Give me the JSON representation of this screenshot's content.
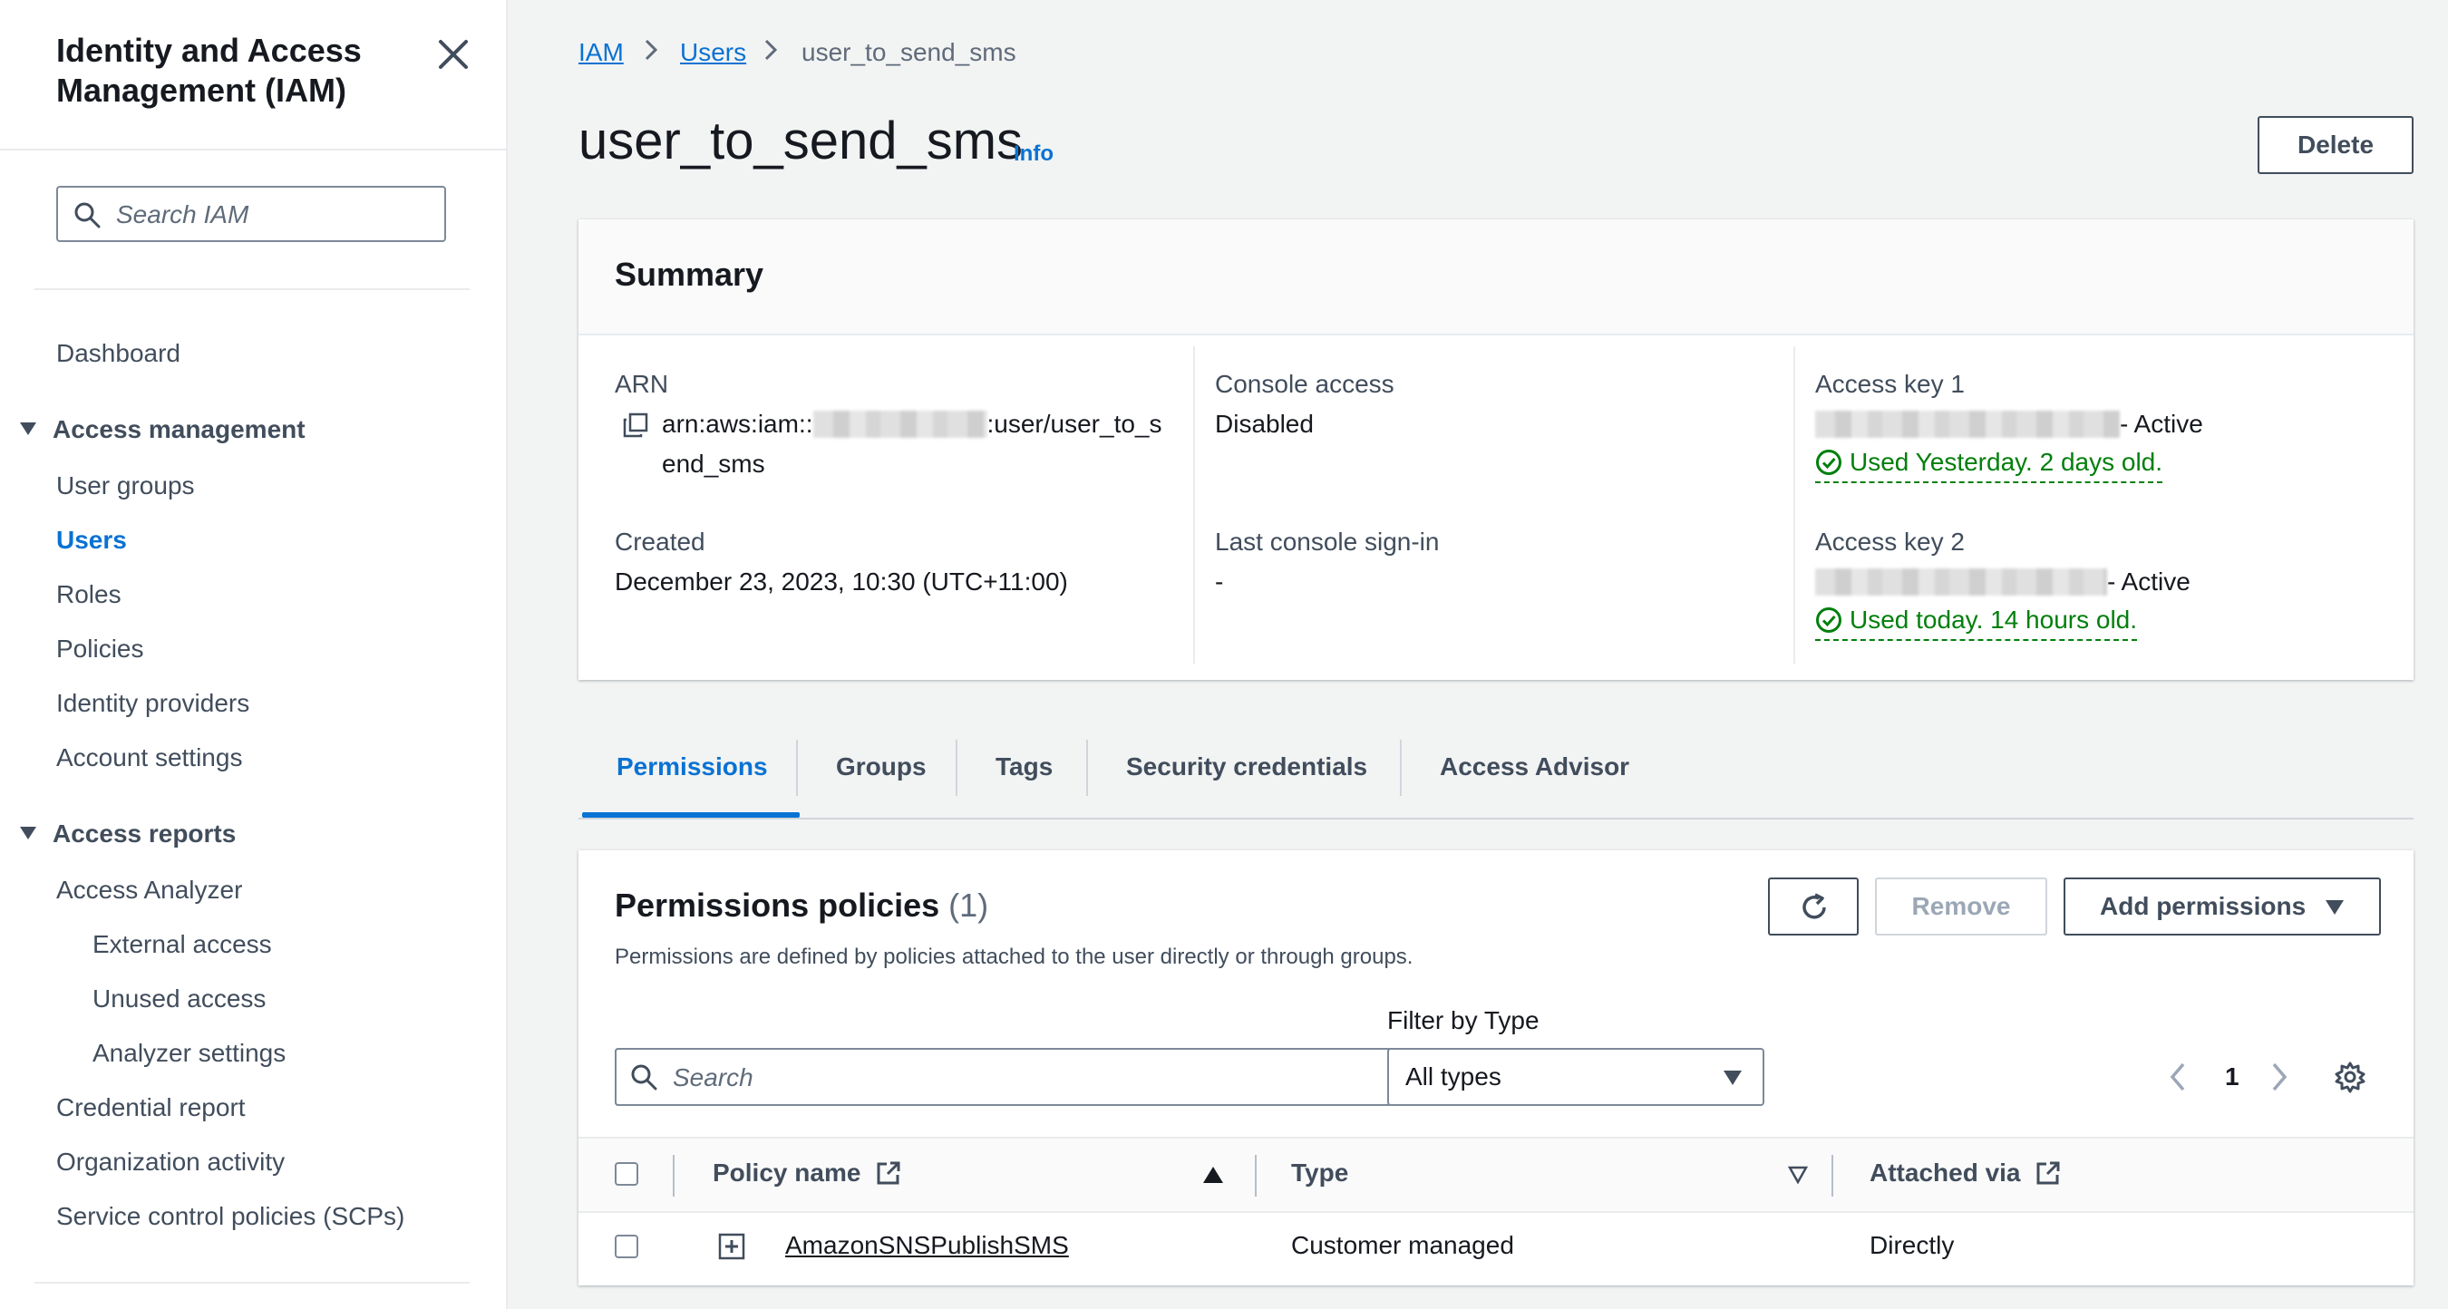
{
  "sidebar": {
    "title": "Identity and Access Management (IAM)",
    "search_placeholder": "Search IAM",
    "dashboard": "Dashboard",
    "sections": [
      {
        "label": "Access management",
        "items": [
          "User groups",
          "Users",
          "Roles",
          "Policies",
          "Identity providers",
          "Account settings"
        ]
      },
      {
        "label": "Access reports",
        "items": [
          "Access Analyzer",
          "External access",
          "Unused access",
          "Analyzer settings",
          "Credential report",
          "Organization activity",
          "Service control policies (SCPs)"
        ]
      }
    ],
    "active_item": "Users"
  },
  "breadcrumb": [
    "IAM",
    "Users",
    "user_to_send_sms"
  ],
  "page": {
    "title": "user_to_send_sms",
    "info": "Info",
    "delete_label": "Delete"
  },
  "summary": {
    "title": "Summary",
    "arn_label": "ARN",
    "arn_prefix": "arn:aws:iam::",
    "arn_suffix_line1": ":user/user_to_s",
    "arn_suffix_line2": "end_sms",
    "created_label": "Created",
    "created_value": "December 23, 2023, 10:30 (UTC+11:00)",
    "console_access_label": "Console access",
    "console_access_value": "Disabled",
    "last_signin_label": "Last console sign-in",
    "last_signin_value": "-",
    "access_key1_label": "Access key 1",
    "access_key1_status": "- Active",
    "access_key1_used": "Used Yesterday. 2 days old.",
    "access_key2_label": "Access key 2",
    "access_key2_status": "- Active",
    "access_key2_used": "Used today. 14 hours old."
  },
  "tabs": [
    "Permissions",
    "Groups",
    "Tags",
    "Security credentials",
    "Access Advisor"
  ],
  "permissions": {
    "title": "Permissions policies",
    "count": "(1)",
    "description": "Permissions are defined by policies attached to the user directly or through groups.",
    "remove_label": "Remove",
    "add_label": "Add permissions",
    "search_placeholder": "Search",
    "filter_label": "Filter by Type",
    "filter_value": "All types",
    "page_number": "1",
    "columns": [
      "Policy name",
      "Type",
      "Attached via"
    ],
    "rows": [
      {
        "name": "AmazonSNSPublishSMS",
        "type": "Customer managed",
        "attached_via": "Directly"
      }
    ]
  },
  "colors": {
    "accent": "#0972d3",
    "success": "#037f0c",
    "text": "#16191f"
  }
}
